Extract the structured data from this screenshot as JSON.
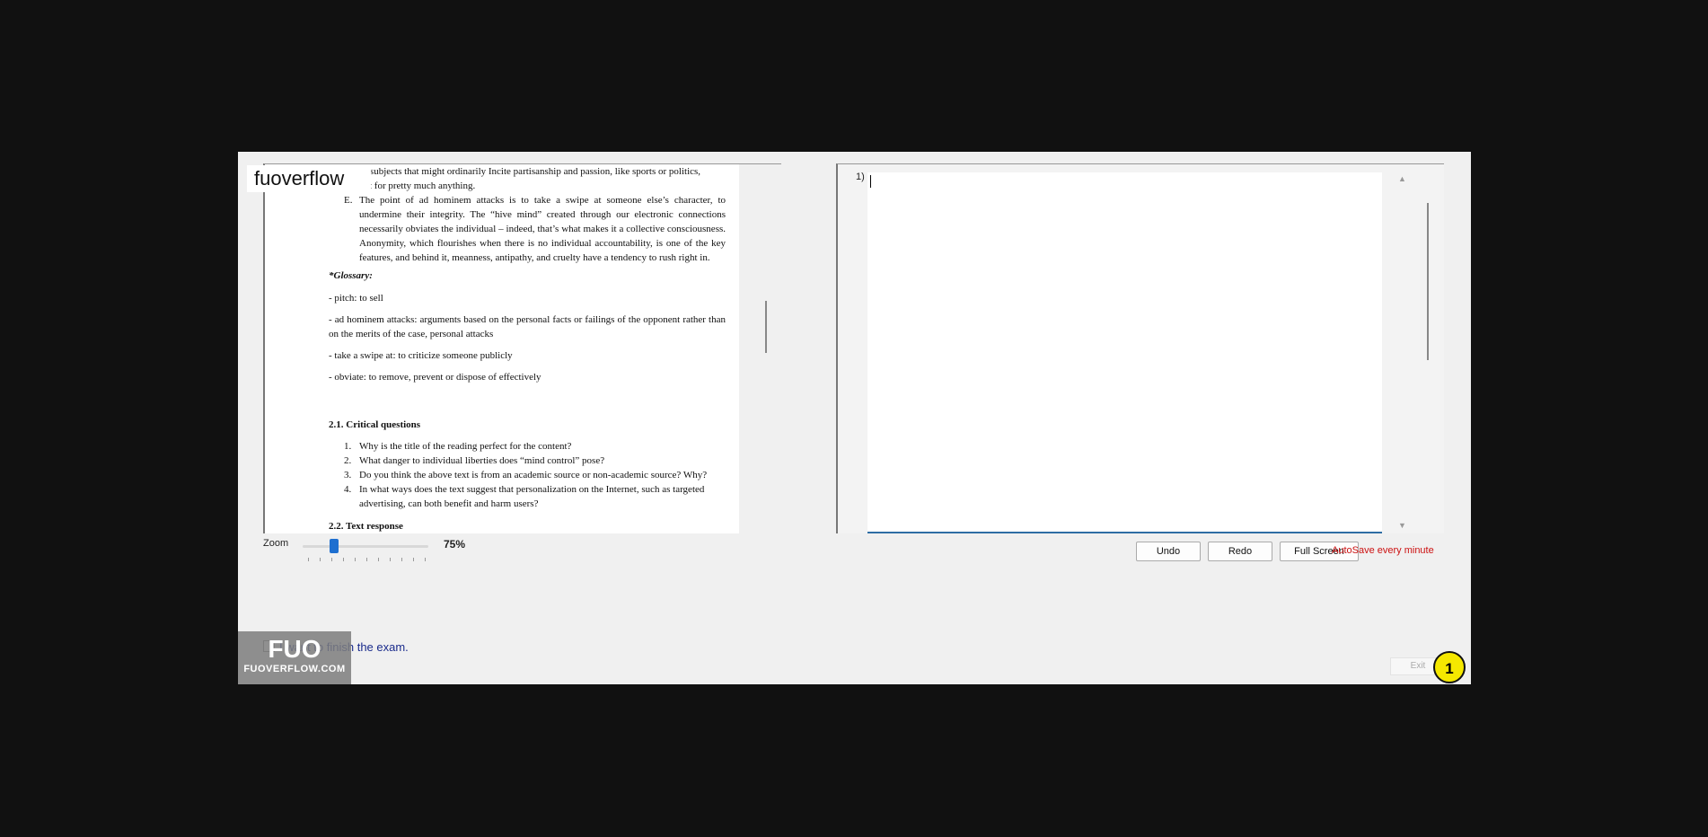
{
  "brand": {
    "label": "fuoverflow"
  },
  "document": {
    "frag1_line1": "or subjects that might ordinarily Incite partisanship and passion, like sports or politics,",
    "frag1_line2": "out for pretty much anything.",
    "itemE_marker": "E.",
    "itemE_text": "The point of ad hominem attacks is to take a swipe at someone else’s character, to undermine their integrity. The “hive mind” created through our electronic connections necessarily obviates the individual – indeed, that’s what makes it a collective consciousness. Anonymity, which flourishes when there is no individual accountability, is one of the key features, and behind it, meanness, antipathy, and cruelty have a tendency to rush right in.",
    "glossary_heading": "*Glossary:",
    "glossary": [
      "- pitch: to sell",
      "- ad hominem attacks: arguments based on the personal facts or failings of the opponent rather than on the merits of the case, personal attacks",
      "- take a swipe at: to criticize someone publicly",
      "- obviate: to remove, prevent or dispose of effectively"
    ],
    "section_heading": "2.1. Critical questions",
    "questions": [
      {
        "num": "1.",
        "text": "Why is the title of the reading perfect for the content?"
      },
      {
        "num": "2.",
        "text": "What danger to individual liberties does “mind control” pose?"
      },
      {
        "num": "3.",
        "text": "Do you think the above text is from an academic source or non-academic source? Why?"
      },
      {
        "num": "4.",
        "text": "In what ways does the text suggest that personalization on the Internet, such as targeted advertising, can both benefit and harm users?"
      }
    ],
    "next_heading": "2.2. Text response"
  },
  "answer": {
    "number": "1)",
    "value": ""
  },
  "toolbar": {
    "zoom_label": "Zoom",
    "zoom_value": "75%",
    "zoom_level_fraction": 0.25,
    "undo_label": "Undo",
    "redo_label": "Redo",
    "fullscreen_label": "Full Screen",
    "autosave_text": "AutoSave every minute"
  },
  "finish": {
    "label": "I want to finish the exam."
  },
  "logo": {
    "mark": "FUO",
    "text": "FUOVERFLOW.COM"
  },
  "exit_label": "Exit",
  "badge_number": "1",
  "colors": {
    "accent": "#1e6fd0",
    "autosave": "#cc1111",
    "finish_text": "#1a2b8c",
    "badge": "#f5e800"
  }
}
